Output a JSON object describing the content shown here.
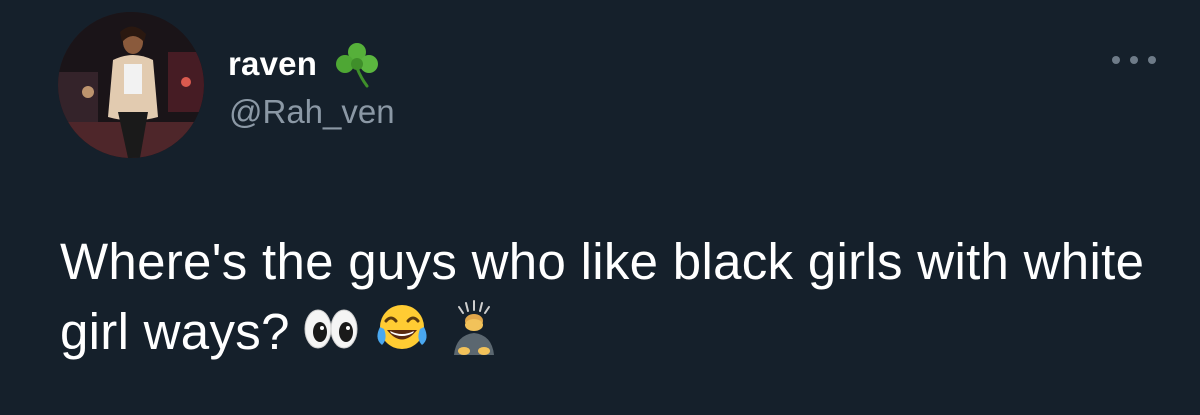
{
  "author": {
    "display_name": "raven",
    "name_emoji": "shamrock-icon",
    "handle": "@Rah_ven"
  },
  "tweet": {
    "text": "Where's the guys who like black girls with white girl ways?",
    "emojis": [
      "eyes-icon",
      "face-with-tears-of-joy-icon",
      "person-bowing-icon"
    ]
  },
  "colors": {
    "background": "#15202b",
    "primary_text": "#ffffff",
    "secondary_text": "#8b98a5",
    "more_dots": "#6e7b88"
  }
}
